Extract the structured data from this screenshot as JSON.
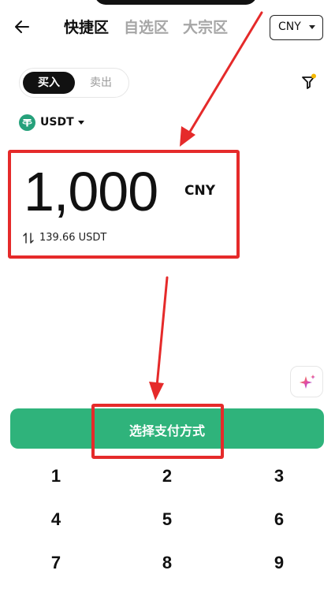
{
  "header": {
    "tabs": [
      {
        "label": "快捷区",
        "active": true
      },
      {
        "label": "自选区",
        "active": false
      },
      {
        "label": "大宗区",
        "active": false
      }
    ],
    "fiat_select": "CNY"
  },
  "trade_toggle": {
    "buy_label": "买入",
    "sell_label": "卖出",
    "selected": "买入"
  },
  "crypto_select": {
    "label": "USDT",
    "icon": "tether-logo-icon"
  },
  "amount": {
    "value": "1,000",
    "currency": "CNY",
    "converted": "139.66 USDT"
  },
  "cta": {
    "label": "选择支付方式"
  },
  "keypad": {
    "keys": [
      "1",
      "2",
      "3",
      "4",
      "5",
      "6",
      "7",
      "8",
      "9"
    ]
  },
  "colors": {
    "accent": "#2fb37b",
    "annotation": "#e52a2a",
    "tether": "#26a17b",
    "filter_dot": "#f5b800"
  }
}
